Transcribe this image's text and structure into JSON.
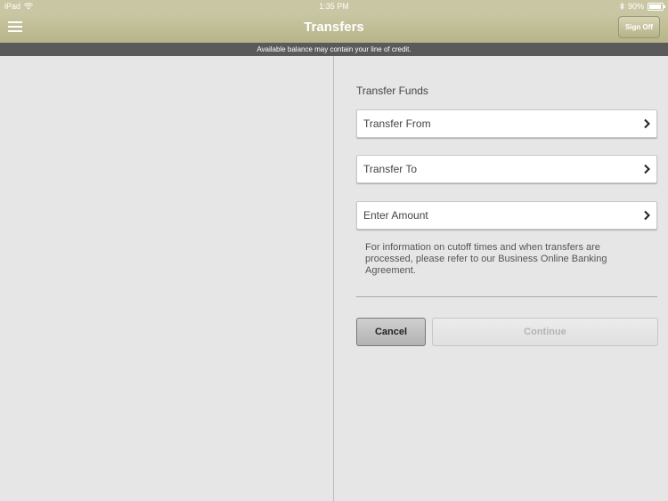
{
  "status_bar": {
    "device": "iPad",
    "time": "1:35 PM",
    "battery_percent": "90%",
    "battery_level": 0.9
  },
  "nav": {
    "title": "Transfers",
    "sign_off_label": "Sign Off"
  },
  "notice": "Available balance may contain your line of credit.",
  "transfer_form": {
    "section_title": "Transfer Funds",
    "fields": [
      {
        "label": "Transfer From"
      },
      {
        "label": "Transfer To"
      },
      {
        "label": "Enter Amount"
      }
    ],
    "info_text": "For information on cutoff times and when transfers are processed, please refer to our Business Online Banking Agreement.",
    "cancel_label": "Cancel",
    "continue_label": "Continue"
  },
  "colors": {
    "nav_background": "#c9c7a3",
    "notice_background": "#5a5a5a",
    "panel_background": "#e6e6e6"
  }
}
